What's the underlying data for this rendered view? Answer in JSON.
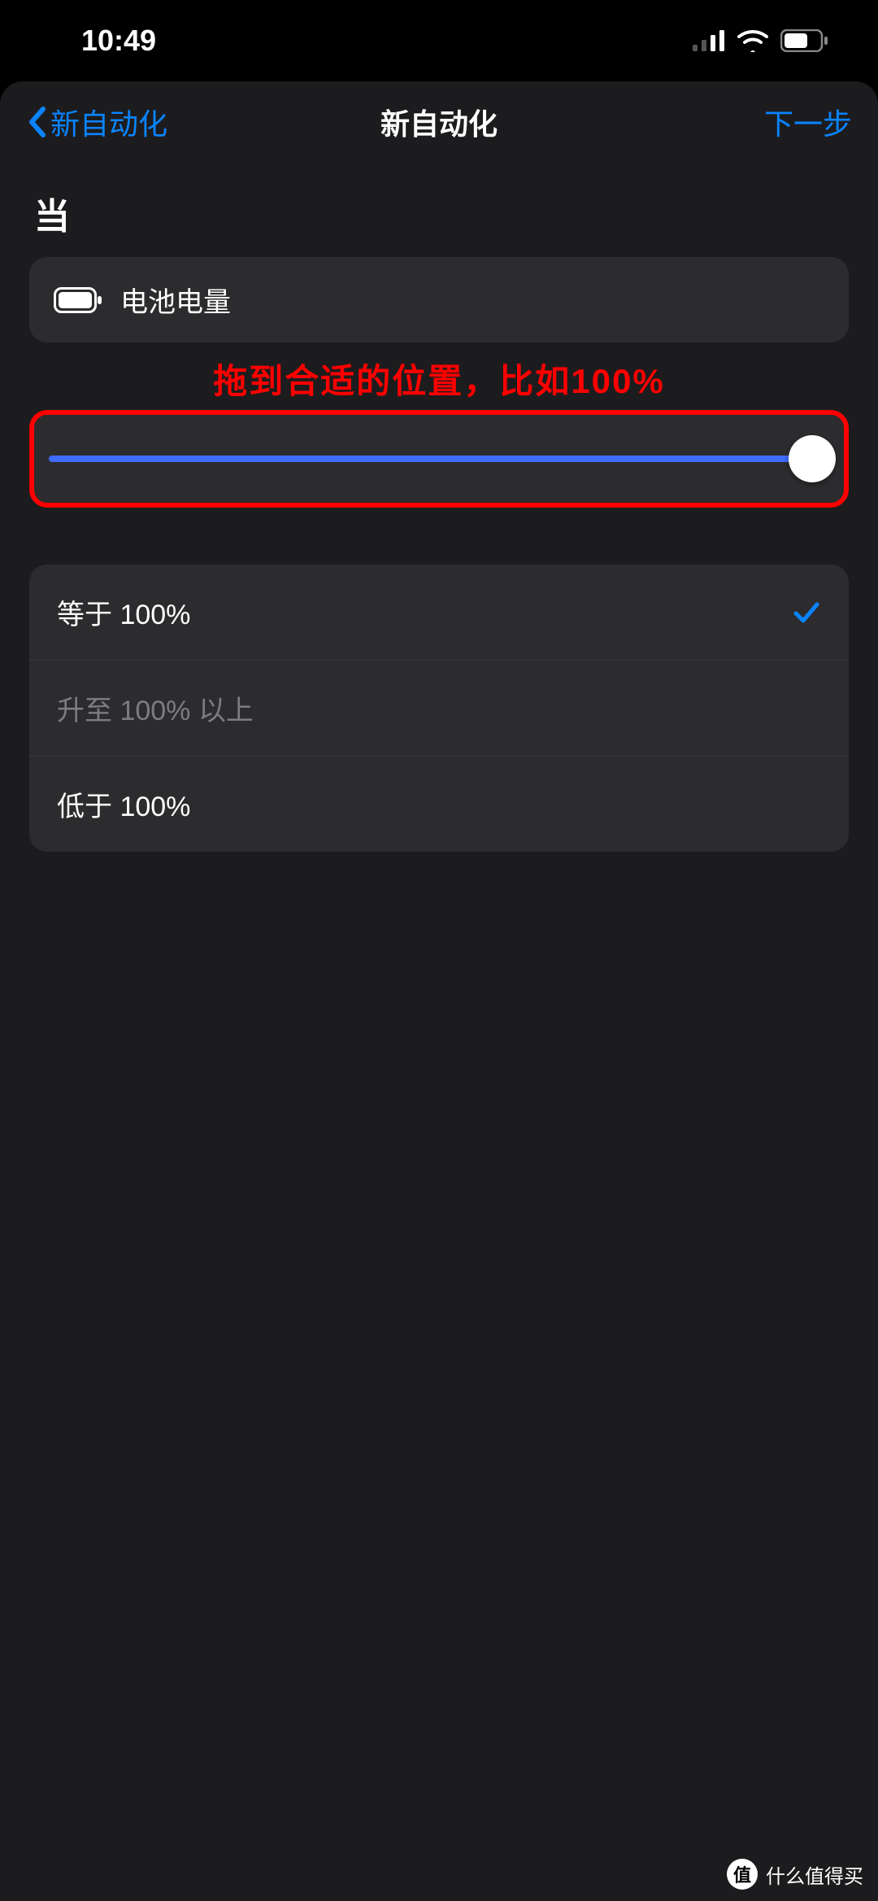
{
  "status": {
    "time": "10:49"
  },
  "nav": {
    "back": "新自动化",
    "title": "新自动化",
    "next": "下一步"
  },
  "section": {
    "when": "当"
  },
  "trigger": {
    "label": "电池电量"
  },
  "annotation": {
    "text": "拖到合适的位置，比如100%"
  },
  "slider": {
    "value": 100,
    "min": 0,
    "max": 100
  },
  "options": {
    "items": [
      {
        "label": "等于 100%",
        "selected": true,
        "disabled": false
      },
      {
        "label": "升至 100% 以上",
        "selected": false,
        "disabled": true
      },
      {
        "label": "低于 100%",
        "selected": false,
        "disabled": false
      }
    ]
  },
  "watermark": {
    "badge": "值",
    "text": "什么值得买"
  },
  "colors": {
    "accent": "#0a84ff",
    "annotation": "#ff0000",
    "card": "#2c2c2e",
    "modal": "#1c1c1e"
  }
}
